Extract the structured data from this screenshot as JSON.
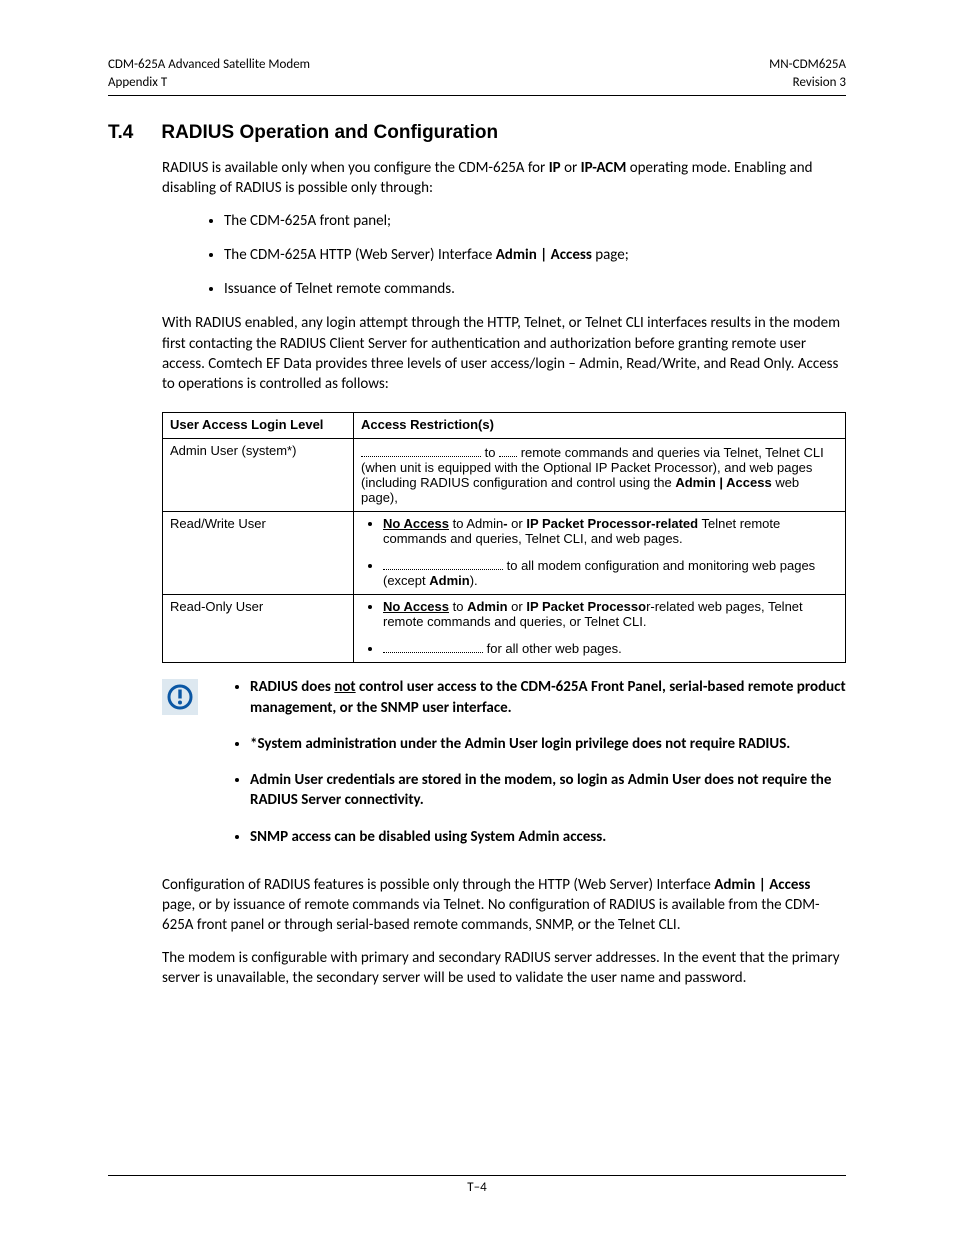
{
  "header": {
    "left1": "CDM-625A Advanced Satellite Modem",
    "left2": "Appendix T",
    "right1": "MN-CDM625A",
    "right2": "Revision 3"
  },
  "heading": {
    "num": "T.4",
    "title": "RADIUS Operation and Configuration"
  },
  "p1_a": "RADIUS is available only when you configure the CDM-625A for ",
  "p1_b": "IP",
  "p1_c": " or ",
  "p1_d": "IP-ACM",
  "p1_e": " operating mode. Enabling and disabling of RADIUS is possible only through:",
  "bul1": "The CDM-625A front panel;",
  "bul2_a": "The CDM-625A HTTP (Web Server) Interface ",
  "bul2_b": "Admin | Access",
  "bul2_c": " page;",
  "bul3": "Issuance of Telnet remote commands.",
  "p2": "With RADIUS enabled, any login attempt through the HTTP, Telnet, or Telnet CLI interfaces results in the modem first contacting the RADIUS Client Server for authentication and authorization before granting remote user access. Comtech EF Data provides three levels of user access/login – Admin, Read/Write, and Read Only. Access to operations is controlled as follows:",
  "table": {
    "h1": "User Access Login Level",
    "h2": "Access Restriction(s)",
    "r1c1": "Admin User (system*)",
    "r1c2_a": " to ",
    "r1c2_b": " remote commands and queries via Telnet, Telnet CLI (when unit is equipped with the Optional IP Packet Processor), and web pages (including RADIUS configuration and control using the ",
    "r1c2_c": "Admin | Access",
    "r1c2_d": " web page),",
    "r2c1": "Read/Write User",
    "r2b1_a": "No Access",
    "r2b1_b": " to Admin",
    "r2b1_c": "-",
    "r2b1_d": " or ",
    "r2b1_e": "IP Packet Processor-related",
    "r2b1_f": " Telnet remote commands and queries, Telnet CLI, and web pages.",
    "r2b2_a": " to all modem configuration and monitoring web pages (except ",
    "r2b2_b": "Admin",
    "r2b2_c": ").",
    "r3c1": "Read-Only User",
    "r3b1_a": "No Access",
    "r3b1_b": " to ",
    "r3b1_c": "Admin",
    "r3b1_d": " or ",
    "r3b1_e": "IP Packet Processo",
    "r3b1_f": "r-related web pages, Telnet remote commands and queries, or Telnet CLI.",
    "r3b2_a": " for all other web pages."
  },
  "note": {
    "n1_a": "RADIUS does ",
    "n1_b": "not",
    "n1_c": " control user access to the CDM-625A Front Panel, serial-based remote product management, or the SNMP user interface.",
    "n2": "*System administration under the Admin User login privilege does not require RADIUS.",
    "n3": "Admin User credentials are stored in the modem, so login as Admin User does not require the RADIUS Server connectivity.",
    "n4": "SNMP access can be disabled using System Admin access."
  },
  "p3_a": "Configuration of RADIUS features is possible only through the HTTP (Web Server) Interface ",
  "p3_b": "Admin | Access",
  "p3_c": " page, or by issuance of remote commands via Telnet. No configuration of RADIUS is available from the CDM-625A front panel or through serial-based remote commands, SNMP, or the Telnet CLI.",
  "p4": "The modem is configurable with primary and secondary RADIUS server addresses. In the event that the primary server is unavailable, the secondary server will be used to validate the user name and password.",
  "footer": "T–4"
}
